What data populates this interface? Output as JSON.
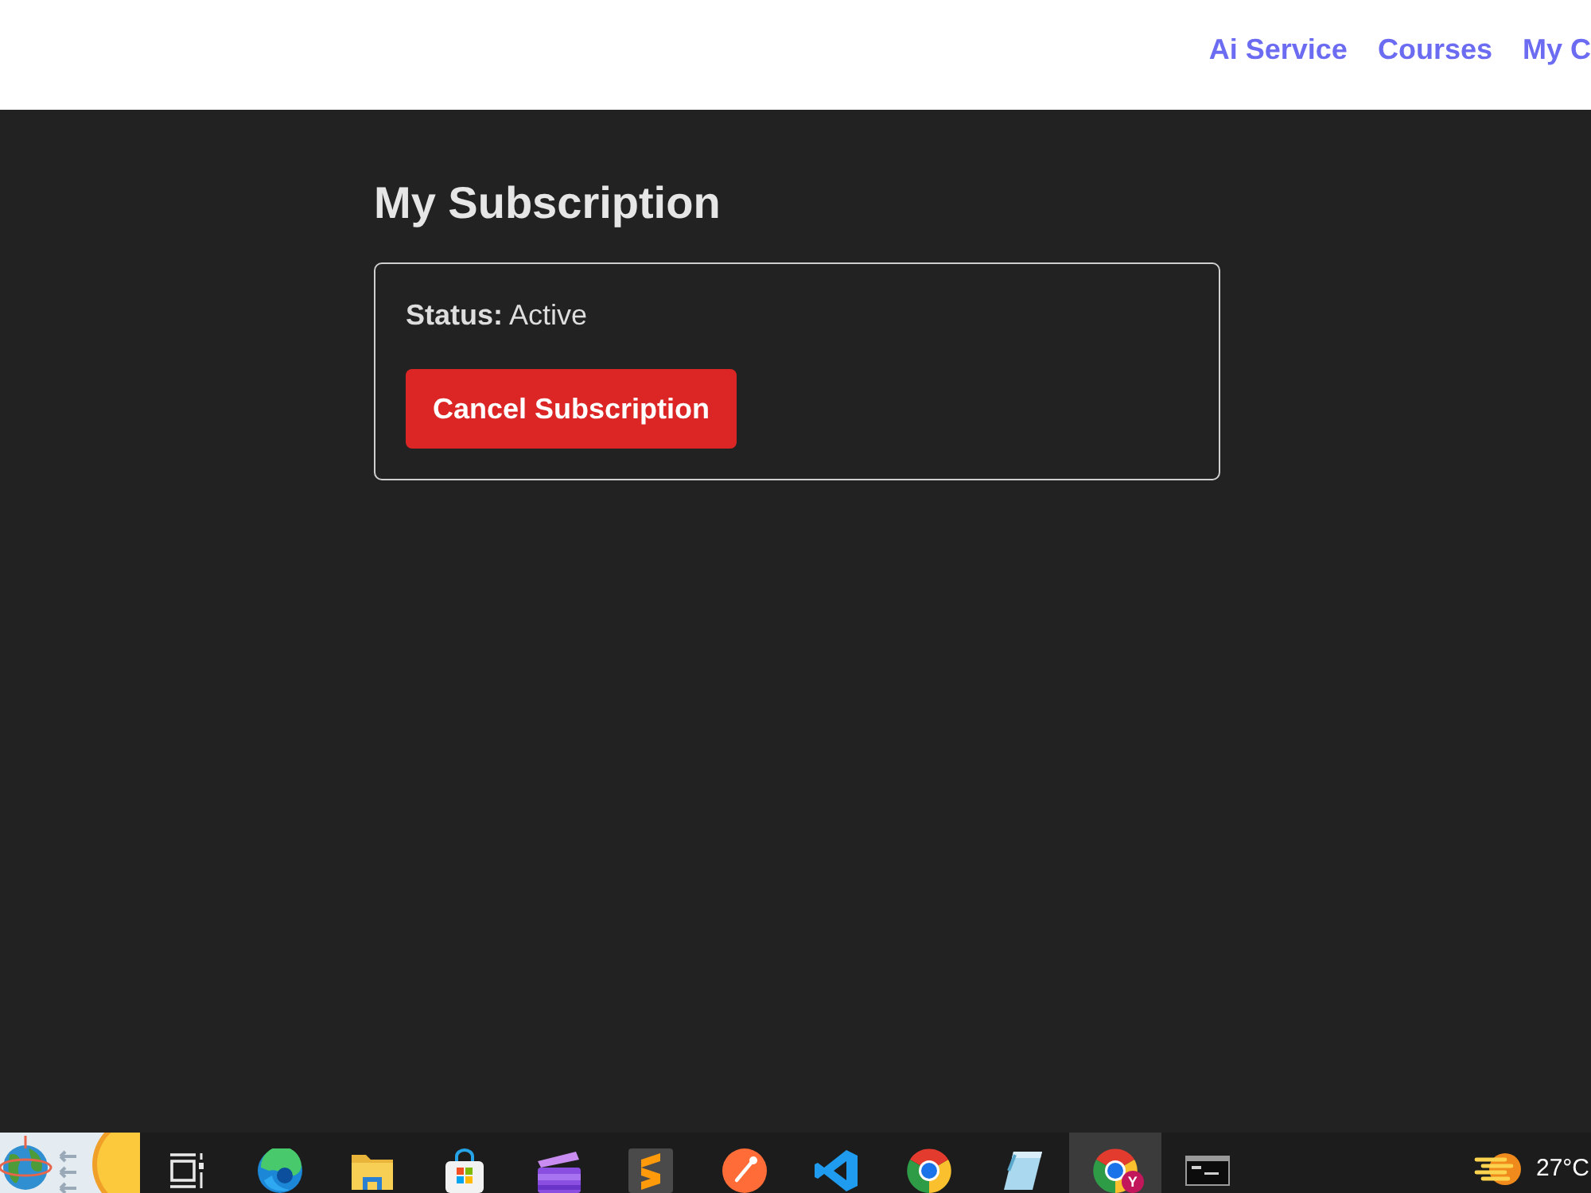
{
  "header": {
    "nav_links": [
      {
        "label": "Ai Service"
      },
      {
        "label": "Courses"
      },
      {
        "label": "My C"
      }
    ]
  },
  "page": {
    "title": "My Subscription",
    "card": {
      "status": "**Status:** Active",
      "button": "Cancel Subscription"
    }
  },
  "taskbar": {
    "apps": [
      {
        "kind": "taskview",
        "selected": false
      },
      {
        "kind": "wave",
        "selected": false
      },
      {
        "kind": "folder",
        "selected": false
      },
      {
        "kind": "bag",
        "selected": false
      },
      {
        "kind": "clapper",
        "selected": false
      },
      {
        "kind": "stripes",
        "selected": false
      },
      {
        "kind": "disc",
        "selected": false
      },
      {
        "kind": "ribbon",
        "selected": false
      },
      {
        "kind": "browser",
        "selected": false
      },
      {
        "kind": "notepad",
        "selected": false
      },
      {
        "kind": "browser",
        "selected": true,
        "badge": "Y"
      },
      {
        "kind": "terminal",
        "selected": false
      }
    ],
    "weather": {
      "temperature": "27°C"
    }
  }
}
